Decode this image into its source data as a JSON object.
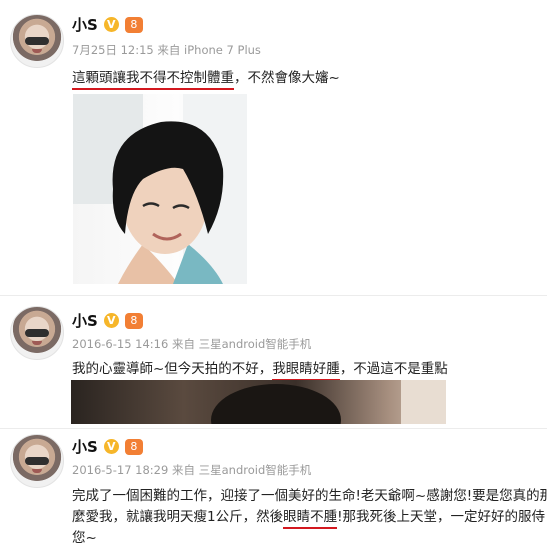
{
  "posts": [
    {
      "name": "小S",
      "meta": "7月25日 12:15 来自 iPhone 7 Plus",
      "text_highlight": "這顆頭讓我不得不控制體重",
      "text_rest": "，不然會像大嬸~",
      "image_desc": "short-hair-selfie"
    },
    {
      "name": "小S",
      "meta": "2016-6-15 14:16 来自 三星android智能手机",
      "text_before": "我的心靈導師~但今天拍的不好，",
      "text_highlight": "我眼睛好腫",
      "text_after": "，不過這不是重點"
    },
    {
      "name": "小S",
      "meta": "2016-5-17 18:29 来自 三星android智能手机",
      "line1": "完成了一個困難的工作，迎接了一個美好的生命!老天爺啊~感謝您!要是您真的那",
      "line2_before": "麼愛我，就讓我明天瘦1公斤，然後",
      "line2_highlight": "眼睛不腫",
      "line2_after": "!那我死後上天堂，一定好好的服侍",
      "line3": "您~"
    }
  ],
  "badges": {
    "verified": "V",
    "level": "8"
  },
  "colors": {
    "underline": "#d3181f",
    "meta": "#9a9a9a",
    "verified": "#f6b62a",
    "level": "#f27f34"
  }
}
